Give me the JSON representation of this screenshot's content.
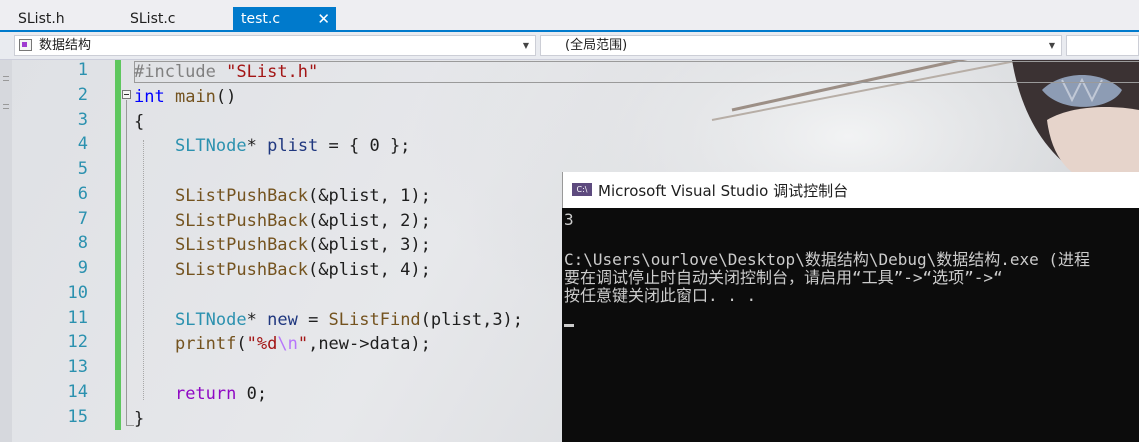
{
  "tabs": [
    {
      "label": "SList.h",
      "active": false
    },
    {
      "label": "SList.c",
      "active": false
    },
    {
      "label": "test.c",
      "active": true,
      "close_icon": "close-icon"
    }
  ],
  "navbar": {
    "project_combo": "数据结构",
    "scope_combo": "(全局范围)",
    "member_combo": ""
  },
  "editor": {
    "line_numbers": [
      "1",
      "2",
      "3",
      "4",
      "5",
      "6",
      "7",
      "8",
      "9",
      "10",
      "11",
      "12",
      "13",
      "14",
      "15"
    ],
    "code": {
      "l1_directive": "#include",
      "l1_header": "\"SList.h\"",
      "l2_type": "int",
      "l2_func": "main",
      "l2_rest": "()",
      "l3": "{",
      "l4_type": "SLTNode",
      "l4_star": "*",
      "l4_var": "plist",
      "l4_rest": " = { 0 };",
      "l6_args": "(&plist, 1);",
      "l7_args": "(&plist, 2);",
      "l8_args": "(&plist, 3);",
      "l9_args": "(&plist, 4);",
      "push_func": "SListPushBack",
      "l11_type": "SLTNode",
      "l11_star": "*",
      "l11_var": "new",
      "l11_eq": " = ",
      "l11_func": "SListFind",
      "l11_args": "(plist,3);",
      "l12_func": "printf",
      "l12_open": "(",
      "l12_str1": "\"%d",
      "l12_esc": "\\n",
      "l12_str2": "\"",
      "l12_rest": ",new->data);",
      "l14_kw": "return",
      "l14_rest": " 0;",
      "l15": "}"
    }
  },
  "console": {
    "title": "Microsoft Visual Studio 调试控制台",
    "icon_label": "C:\\",
    "lines": [
      "3",
      "",
      "C:\\Users\\ourlove\\Desktop\\数据结构\\Debug\\数据结构.exe (进程",
      "要在调试停止时自动关闭控制台，请启用“工具”->“选项”->“",
      "按任意键关闭此窗口. . ."
    ]
  },
  "colors": {
    "accent": "#007acc",
    "line_number": "#2b91af",
    "keyword": "#0000ff",
    "string": "#a31515",
    "change_marker": "#5ec75e",
    "console_bg": "#0c0c0c"
  }
}
